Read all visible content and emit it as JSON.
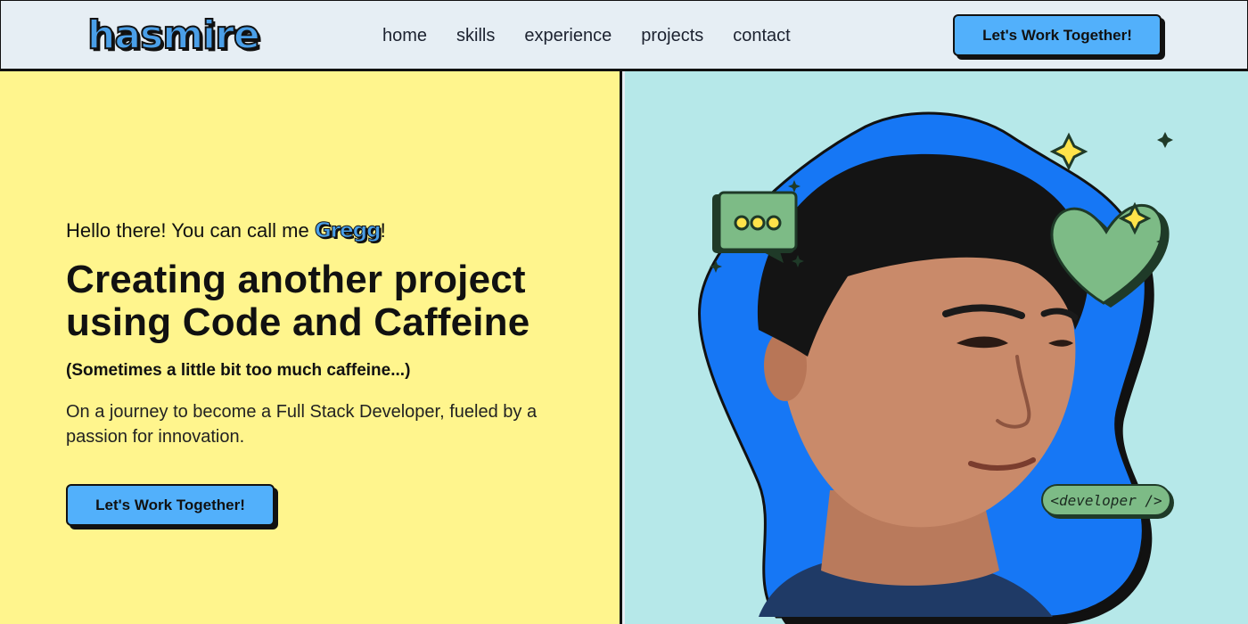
{
  "nav": {
    "logo": "hasmire",
    "links": [
      "home",
      "skills",
      "experience",
      "projects",
      "contact"
    ],
    "cta_label": "Let's Work Together!"
  },
  "hero": {
    "greeting_prefix": "Hello there! You can call me ",
    "name": "Gregg",
    "greeting_suffix": "!",
    "headline": "Creating another project using Code and Caffeine",
    "subnote": "(Sometimes a little bit too much caffeine...)",
    "description": "On a journey to become a Full Stack Developer, fueled by a passion for innovation.",
    "cta_label": "Let's Work Together!",
    "badge": "<developer />"
  },
  "colors": {
    "accent_blue": "#52b0fb",
    "left_bg": "#fff58d",
    "right_bg": "#b6e8e9",
    "blob_blue": "#1677f5",
    "icon_green": "#7dbb86",
    "star_yellow": "#ffe34a"
  },
  "icons": [
    "chat-bubble-icon",
    "heart-icon",
    "sparkle-icon"
  ]
}
